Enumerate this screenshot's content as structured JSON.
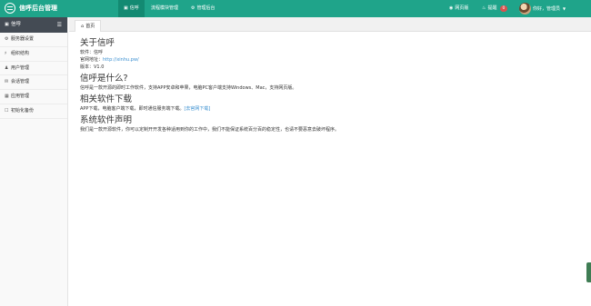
{
  "header": {
    "title": "信呼后台管理",
    "nav": [
      {
        "label": "信呼",
        "icon": "comment-icon"
      },
      {
        "label": "流程模块管理",
        "icon": ""
      },
      {
        "label": "管理后台",
        "icon": "gear-icon"
      }
    ],
    "home": "网页版",
    "reminder": "提醒",
    "reminder_count": "0",
    "user": "你好，管理员"
  },
  "sidebar": {
    "title": "信呼",
    "items": [
      {
        "label": "服务器设置",
        "icon": "gear-icon"
      },
      {
        "label": "组织结构",
        "icon": "sitemap-icon"
      },
      {
        "label": "用户管理",
        "icon": "user-icon"
      },
      {
        "label": "会话管理",
        "icon": "comments-icon"
      },
      {
        "label": "应用管理",
        "icon": "apps-icon"
      },
      {
        "label": "初始化备份",
        "icon": "bookmark-icon"
      }
    ]
  },
  "tabs": [
    {
      "label": "首页",
      "icon": "home-icon"
    }
  ],
  "main": {
    "about_title": "关于信呼",
    "software": "软件：信呼",
    "website_label": "官网地址：",
    "website_url": "http://xinhu.pw/",
    "version": "版本：V1.0",
    "what_title": "信呼是什么?",
    "what_desc": "信呼是一款开源的即时工作软件，支持APP安卓和苹果，电脑PC客户端支持Windows、Mac，支持网页版。",
    "related_title": "相关软件下载",
    "related_desc": "APP下载，电脑客户端下载，即时通信服务端下载。",
    "related_link": "[去官网下载]",
    "statement_title": "系统软件声明",
    "statement_desc": "我们是一款开源软件，你可以定制开开发各种适用到你的工作中，我们不能保证系统百分百的稳定性，也请不要恶意去破坏程序。"
  }
}
